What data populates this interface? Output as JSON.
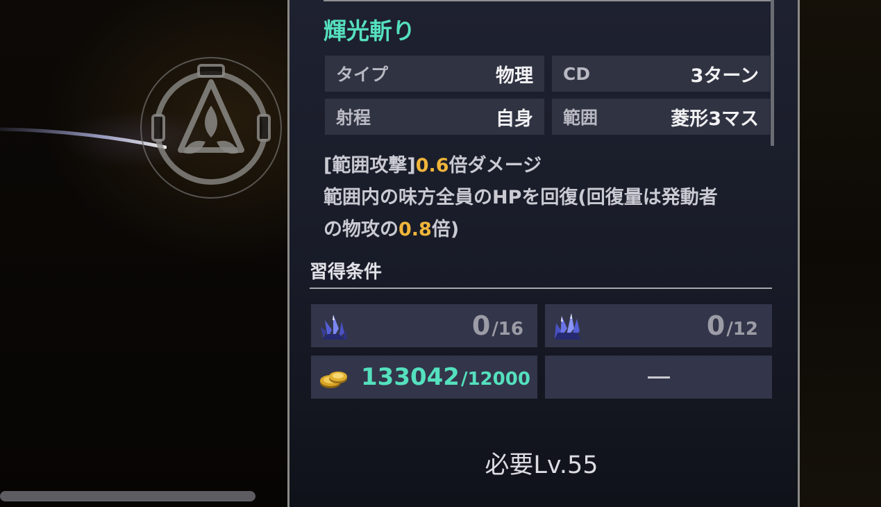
{
  "skill": {
    "name": "輝光斬り",
    "stats": [
      {
        "label": "タイプ",
        "value": "物理"
      },
      {
        "label": "CD",
        "value": "3ターン"
      },
      {
        "label": "射程",
        "value": "自身"
      },
      {
        "label": "範囲",
        "value": "菱形3マス"
      }
    ],
    "description": {
      "line1_prefix": "[範囲攻撃]",
      "line1_value": "0.6",
      "line1_suffix": "倍ダメージ",
      "line2": "範囲内の味方全員のHPを回復(回復量は発動者",
      "line3_prefix": "の物攻の",
      "line3_value": "0.8",
      "line3_suffix": "倍)"
    }
  },
  "requirements": {
    "title": "習得条件",
    "items": [
      {
        "icon": "blue-crystal-icon",
        "have": "0",
        "need": "/16"
      },
      {
        "icon": "blue-crystal-cluster-icon",
        "have": "0",
        "need": "/12"
      },
      {
        "icon": "gold-coins-icon",
        "have": "133042",
        "need": "/12000"
      },
      {
        "icon": "none",
        "placeholder": "—"
      }
    ]
  },
  "required_level": "必要Lv.55",
  "colors": {
    "accent": "#55e0be",
    "highlight": "#f0b53a",
    "panel_bg": "#1e2130",
    "cell_bg": "#303342"
  }
}
